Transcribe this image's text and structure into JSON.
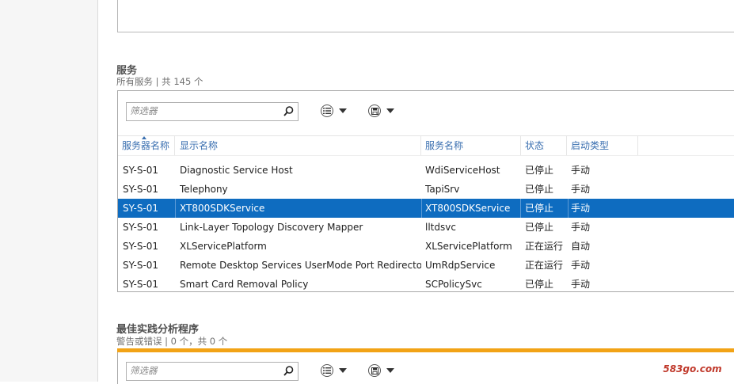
{
  "services": {
    "title": "服务",
    "subtitle": "所有服务 | 共 145 个",
    "filter_placeholder": "筛选器",
    "columns": [
      "服务器名称",
      "显示名称",
      "服务名称",
      "状态",
      "启动类型"
    ],
    "rows": [
      {
        "server": "SY-S-01",
        "display": "Diagnostic Service Host",
        "service": "WdiServiceHost",
        "status": "已停止",
        "startup": "手动",
        "selected": false
      },
      {
        "server": "SY-S-01",
        "display": "Telephony",
        "service": "TapiSrv",
        "status": "已停止",
        "startup": "手动",
        "selected": false
      },
      {
        "server": "SY-S-01",
        "display": "XT800SDKService",
        "service": "XT800SDKService",
        "status": "已停止",
        "startup": "手动",
        "selected": true
      },
      {
        "server": "SY-S-01",
        "display": "Link-Layer Topology Discovery Mapper",
        "service": "lltdsvc",
        "status": "已停止",
        "startup": "手动",
        "selected": false
      },
      {
        "server": "SY-S-01",
        "display": "XLServicePlatform",
        "service": "XLServicePlatform",
        "status": "正在运行",
        "startup": "自动",
        "selected": false
      },
      {
        "server": "SY-S-01",
        "display": "Remote Desktop Services UserMode Port Redirector",
        "service": "UmRdpService",
        "status": "正在运行",
        "startup": "手动",
        "selected": false
      },
      {
        "server": "SY-S-01",
        "display": "Smart Card Removal Policy",
        "service": "SCPolicySvc",
        "status": "已停止",
        "startup": "手动",
        "selected": false
      }
    ]
  },
  "bpa": {
    "title": "最佳实践分析程序",
    "subtitle": "警告或错误 | 0 个，共 0 个",
    "filter_placeholder": "筛选器"
  },
  "watermark": "583go.com",
  "icons": {
    "search": "search-icon",
    "list_options": "list-options-icon",
    "save": "save-icon",
    "dropdown": "caret-down-icon"
  },
  "colors": {
    "selection": "#0e6cc0",
    "header_text": "#3a6fb0",
    "warning_bar": "#f2a316"
  }
}
